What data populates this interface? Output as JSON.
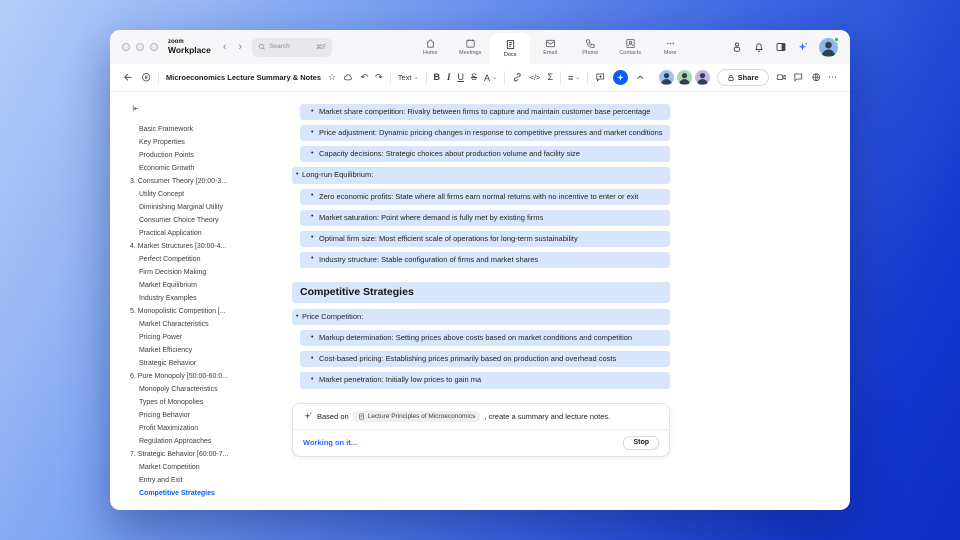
{
  "topbar": {
    "logo_line1": "zoom",
    "logo_line2": "Workplace",
    "nav_back": "‹",
    "nav_forward": "›",
    "search": {
      "placeholder": "Search",
      "shortcut": "⌘F"
    },
    "tabs": [
      {
        "id": "home",
        "label": "Home",
        "icon": "home-icon",
        "active": false
      },
      {
        "id": "meetings",
        "label": "Meetings",
        "icon": "calendar-icon",
        "active": false
      },
      {
        "id": "docs",
        "label": "Docs",
        "icon": "doc-icon",
        "active": true
      },
      {
        "id": "email",
        "label": "Email",
        "icon": "email-icon",
        "active": false
      },
      {
        "id": "phone",
        "label": "Phone",
        "icon": "phone-icon",
        "active": false
      },
      {
        "id": "contacts",
        "label": "Contacts",
        "icon": "contacts-icon",
        "active": false
      },
      {
        "id": "more",
        "label": "More",
        "icon": "more-icon",
        "active": false
      }
    ],
    "right_icons": [
      "assistant-icon",
      "bell-icon",
      "panel-toggle-icon",
      "ai-sparkle-icon"
    ]
  },
  "toolbar": {
    "title": "Microeconomics Lecture Summary & Notes",
    "text_style_label": "Text",
    "glyphs": {
      "bold": "B",
      "italic": "I",
      "underline": "U",
      "strikethrough": "S",
      "text_color": "A",
      "code": "</>",
      "formula": "Σ",
      "list": "≡",
      "undo": "↶",
      "redo": "↷",
      "star": "☆",
      "more": "⋯",
      "chevron": "⌄",
      "chevron_up": "⌃"
    },
    "collaborator_avatar_colors": [
      "#9cc3ef",
      "#a9d8b2",
      "#c9b3e8"
    ],
    "share_label": "Share"
  },
  "sidebar": {
    "items": [
      {
        "label": "Basic Framework",
        "level": 2,
        "active": false
      },
      {
        "label": "Key Properties",
        "level": 2,
        "active": false
      },
      {
        "label": "Production Points",
        "level": 2,
        "active": false
      },
      {
        "label": "Economic Growth",
        "level": 2,
        "active": false
      },
      {
        "label": "3. Consumer Theory [20:00-3...",
        "level": 1,
        "active": false
      },
      {
        "label": "Utility Concept",
        "level": 2,
        "active": false
      },
      {
        "label": "Diminishing Marginal Utility",
        "level": 2,
        "active": false
      },
      {
        "label": "Consumer Choice Theory",
        "level": 2,
        "active": false
      },
      {
        "label": "Practical Application",
        "level": 2,
        "active": false
      },
      {
        "label": "4. Market Structures [30:00-4...",
        "level": 1,
        "active": false
      },
      {
        "label": "Perfect Competition",
        "level": 2,
        "active": false
      },
      {
        "label": "Firm Decision Making",
        "level": 2,
        "active": false
      },
      {
        "label": "Market Equilibrium",
        "level": 2,
        "active": false
      },
      {
        "label": "Industry Examples",
        "level": 2,
        "active": false
      },
      {
        "label": "5. Monopolistic Competition [...",
        "level": 1,
        "active": false
      },
      {
        "label": "Market Characteristics",
        "level": 2,
        "active": false
      },
      {
        "label": "Pricing Power",
        "level": 2,
        "active": false
      },
      {
        "label": "Market Efficiency",
        "level": 2,
        "active": false
      },
      {
        "label": "Strategic Behavior",
        "level": 2,
        "active": false
      },
      {
        "label": "6. Pure Monopoly [50:00-60:0...",
        "level": 1,
        "active": false
      },
      {
        "label": "Monopoly Characteristics",
        "level": 2,
        "active": false
      },
      {
        "label": "Types of Monopolies",
        "level": 2,
        "active": false
      },
      {
        "label": "Pricing Behavior",
        "level": 2,
        "active": false
      },
      {
        "label": "Profit Maximization",
        "level": 2,
        "active": false
      },
      {
        "label": "Regulation Approaches",
        "level": 2,
        "active": false
      },
      {
        "label": "7. Strategic Behavior [60:00-7...",
        "level": 1,
        "active": false
      },
      {
        "label": "Market Competition",
        "level": 2,
        "active": false
      },
      {
        "label": "Entry and Exit",
        "level": 2,
        "active": false
      },
      {
        "label": "Competitive Strategies",
        "level": 2,
        "active": true
      }
    ]
  },
  "document": {
    "blocks": [
      {
        "type": "bullet",
        "level": 2,
        "text": "Market share competition: Rivalry between firms to capture and maintain customer base percentage"
      },
      {
        "type": "bullet",
        "level": 2,
        "text": "Price adjustment: Dynamic pricing changes in response to competitive pressures and market conditions"
      },
      {
        "type": "bullet",
        "level": 2,
        "text": "Capacity decisions: Strategic choices about production volume and facility size"
      },
      {
        "type": "bullet",
        "level": 1,
        "text": "Long-run Equilibrium:"
      },
      {
        "type": "bullet",
        "level": 2,
        "text": "Zero economic profits: State where all firms earn normal returns with no incentive to enter or exit"
      },
      {
        "type": "bullet",
        "level": 2,
        "text": "Market saturation: Point where demand is fully met by existing firms"
      },
      {
        "type": "bullet",
        "level": 2,
        "text": "Optimal firm size: Most efficient scale of operations for long-term sustainability"
      },
      {
        "type": "bullet",
        "level": 2,
        "text": "Industry structure: Stable configuration of firms and market shares"
      },
      {
        "type": "heading",
        "text": "Competitive Strategies"
      },
      {
        "type": "bullet",
        "level": 1,
        "text": "Price Competition:"
      },
      {
        "type": "bullet",
        "level": 2,
        "text": "Markup determination: Setting prices above costs based on market conditions and competition"
      },
      {
        "type": "bullet",
        "level": 2,
        "text": "Cost-based pricing: Establishing prices primarily based on production and overhead costs"
      },
      {
        "type": "bullet",
        "level": 2,
        "text": "Market penetration: Initially low prices to gain ma"
      }
    ]
  },
  "ai_panel": {
    "prefix": "Based on",
    "chip_label": "Lecture Principles of Microeconomics",
    "suffix": ", create a summary and lecture notes.",
    "status": "Working on it...",
    "stop_label": "Stop"
  },
  "colors": {
    "accent": "#0b5cff",
    "highlight": "#d7e6fb",
    "background_start": "#b6cdf8",
    "background_end": "#0f2fc2",
    "presence_green": "#16c60c"
  }
}
